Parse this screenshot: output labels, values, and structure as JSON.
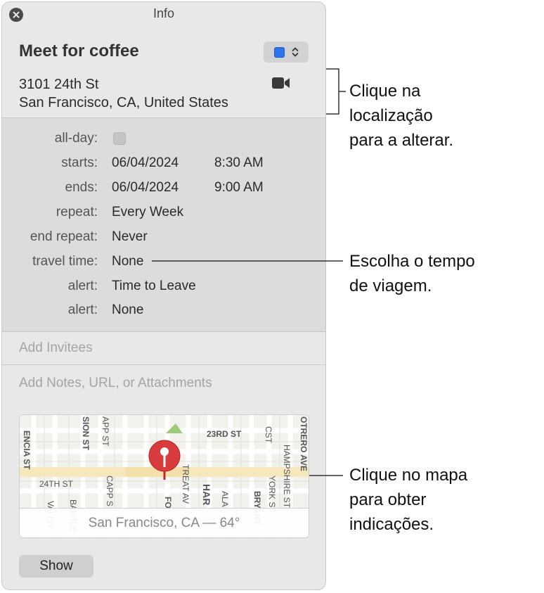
{
  "window": {
    "title": "Info"
  },
  "event": {
    "title": "Meet for coffee",
    "location_line1": "3101 24th St",
    "location_line2": "San Francisco, CA, United States",
    "calendar_color": "#2f74ea"
  },
  "details": {
    "all_day_label": "all-day:",
    "all_day_checked": false,
    "starts_label": "starts:",
    "starts_date": "06/04/2024",
    "starts_time": "8:30 AM",
    "ends_label": "ends:",
    "ends_date": "06/04/2024",
    "ends_time": "9:00 AM",
    "repeat_label": "repeat:",
    "repeat_value": "Every Week",
    "end_repeat_label": "end repeat:",
    "end_repeat_value": "Never",
    "travel_label": "travel time:",
    "travel_value": "None",
    "alert1_label": "alert:",
    "alert1_value": "Time to Leave",
    "alert2_label": "alert:",
    "alert2_value": "None"
  },
  "invitees_placeholder": "Add Invitees",
  "notes_placeholder": "Add Notes, URL, or Attachments",
  "map": {
    "caption": "San Francisco, CA — 64°",
    "streets": [
      "ENCIA ST",
      "SION ST",
      "APP ST",
      "23RD ST",
      "CST",
      "HAMPSHIRE ST",
      "OTRERO AVE",
      "24TH ST",
      "CAPP S",
      "TREAT AV",
      "HAR",
      "ALA",
      "FO",
      "BRYANT",
      "YORK ST",
      "VALEN",
      "BARTLE"
    ]
  },
  "show_button": "Show",
  "callouts": {
    "location": [
      "Clique na",
      "localização",
      "para a alterar."
    ],
    "travel": [
      "Escolha o tempo",
      "de viagem."
    ],
    "map": [
      "Clique no mapa",
      "para obter",
      "indicações."
    ]
  }
}
